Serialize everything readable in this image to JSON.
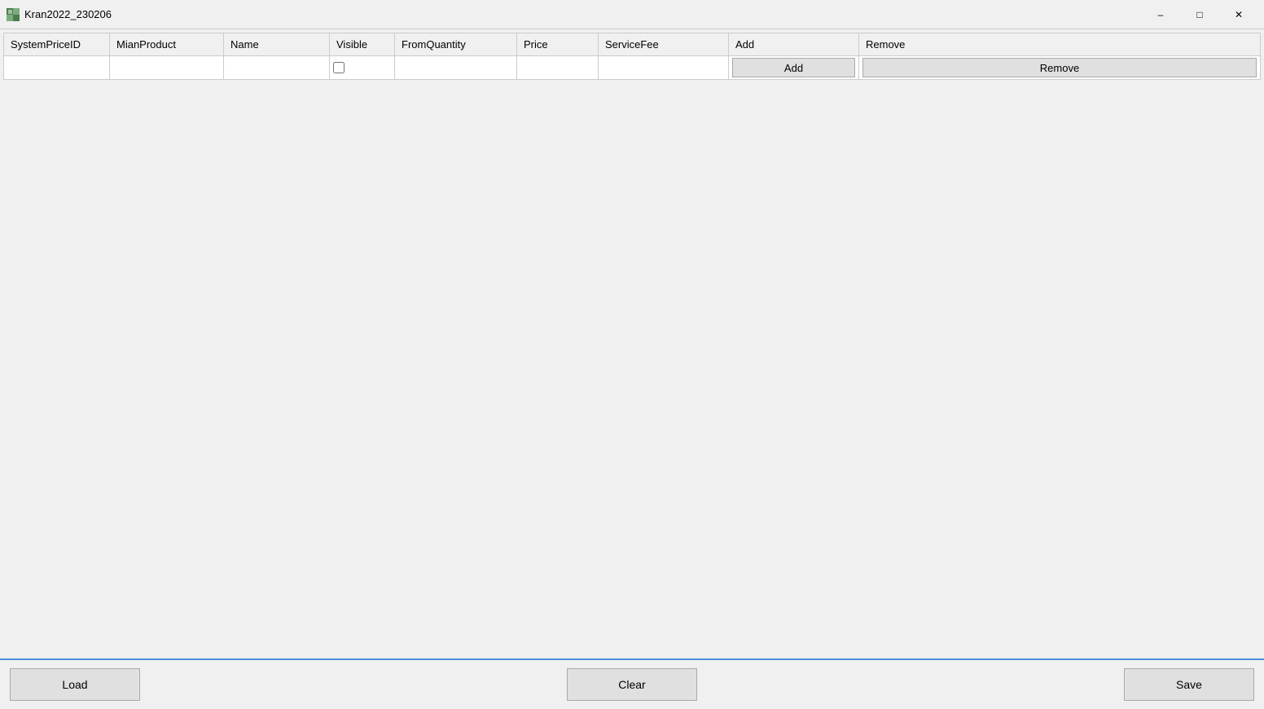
{
  "titleBar": {
    "appName": "Kran2022_230206",
    "minimizeLabel": "–",
    "maximizeLabel": "□",
    "closeLabel": "✕"
  },
  "table": {
    "columns": [
      {
        "key": "systemPriceId",
        "label": "SystemPriceID",
        "class": "col-system-price-id"
      },
      {
        "key": "mianProduct",
        "label": "MianProduct",
        "class": "col-mian-product"
      },
      {
        "key": "name",
        "label": "Name",
        "class": "col-name"
      },
      {
        "key": "visible",
        "label": "Visible",
        "class": "col-visible"
      },
      {
        "key": "fromQuantity",
        "label": "FromQuantity",
        "class": "col-from-quantity"
      },
      {
        "key": "price",
        "label": "Price",
        "class": "col-price"
      },
      {
        "key": "serviceFee",
        "label": "ServiceFee",
        "class": "col-service-fee"
      },
      {
        "key": "add",
        "label": "Add",
        "class": "col-add"
      },
      {
        "key": "remove",
        "label": "Remove",
        "class": "col-remove"
      }
    ],
    "addButtonLabel": "Add",
    "removeButtonLabel": "Remove"
  },
  "footer": {
    "loadLabel": "Load",
    "clearLabel": "Clear",
    "saveLabel": "Save"
  }
}
